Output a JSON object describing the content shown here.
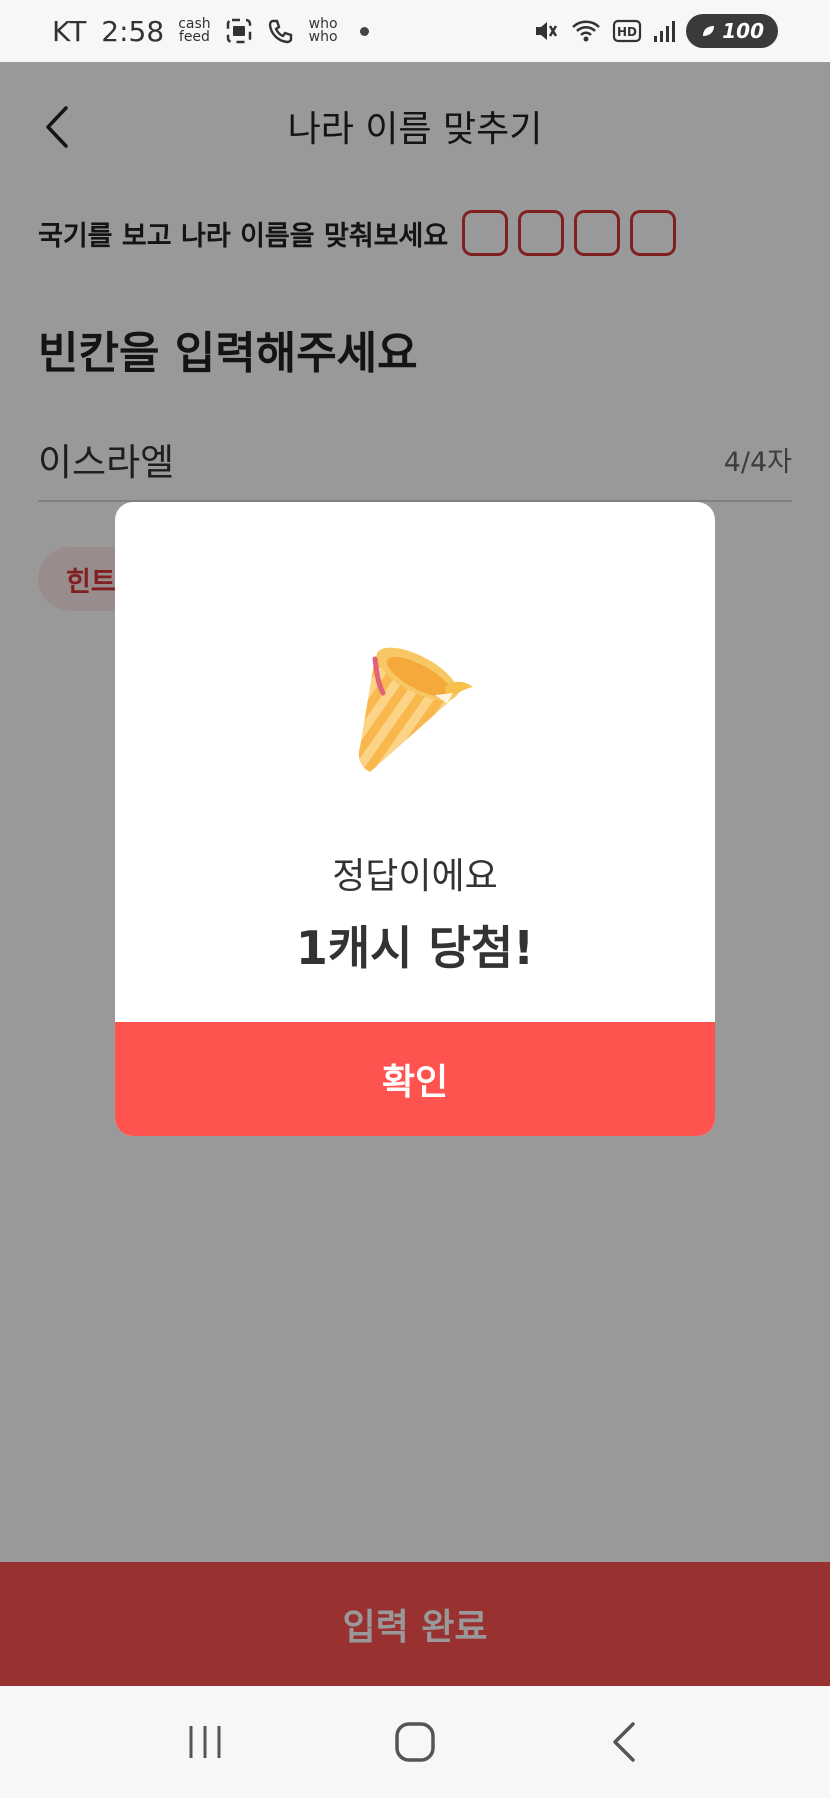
{
  "status_bar": {
    "carrier": "KT",
    "time": "2:58",
    "app1_line1": "cash",
    "app1_line2": "feed",
    "app2_line1": "who",
    "app2_line2": "who",
    "battery": "100",
    "icons": [
      "gallery-icon",
      "phone-icon",
      "mute-icon",
      "wifi-icon",
      "hd-icon",
      "signal-icon",
      "battery-icon"
    ]
  },
  "header": {
    "title": "나라 이름 맞추기",
    "back_icon": "chevron-left-icon"
  },
  "quiz": {
    "instruction": "국기를 보고 나라 이름을 맞춰보세요",
    "blank_count": 4,
    "prompt": "빈칸을 입력해주세요",
    "answer_value": "이스라엘",
    "char_count": "4/4자",
    "hint_label": "힌트"
  },
  "bottom": {
    "submit_label": "입력 완료"
  },
  "modal": {
    "icon": "party-popper-icon",
    "message": "정답이에요",
    "prize": "1캐시 당첨!",
    "confirm_label": "확인"
  },
  "colors": {
    "accent": "#ff5350",
    "blank_border": "#d8363b",
    "overlay": "rgba(0,0,0,0.40)"
  }
}
